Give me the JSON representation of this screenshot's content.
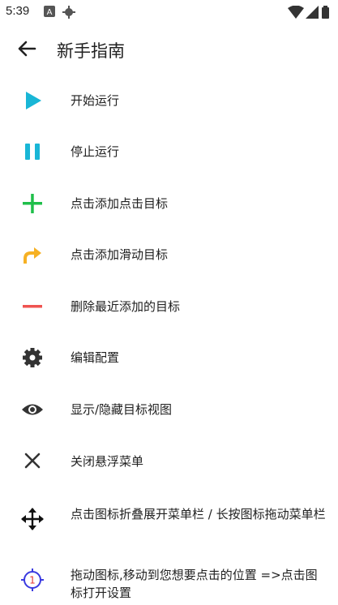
{
  "status_bar": {
    "time": "5:39"
  },
  "app_bar": {
    "title": "新手指南"
  },
  "colors": {
    "play": "#19b6d6",
    "pause": "#19b6d6",
    "add": "#1fbf4a",
    "swipe": "#f6b124",
    "remove": "#ef5350",
    "gear": "#333333",
    "target": "#3a3ae0",
    "target_num": "#e53935"
  },
  "items": [
    {
      "icon": "play-icon",
      "label": "开始运行"
    },
    {
      "icon": "pause-icon",
      "label": "停止运行"
    },
    {
      "icon": "plus-icon",
      "label": "点击添加点击目标"
    },
    {
      "icon": "swipe-arrow-icon",
      "label": "点击添加滑动目标"
    },
    {
      "icon": "minus-icon",
      "label": "删除最近添加的目标"
    },
    {
      "icon": "gear-icon",
      "label": "编辑配置"
    },
    {
      "icon": "eye-icon",
      "label": "显示/隐藏目标视图"
    },
    {
      "icon": "close-icon",
      "label": "关闭悬浮菜单"
    },
    {
      "icon": "move-icon",
      "label": "点击图标折叠展开菜单栏 / 长按图标拖动菜单栏"
    },
    {
      "icon": "target-icon",
      "label": "拖动图标,移动到您想要点击的位置 =>点击图标打开设置",
      "badge": "1"
    }
  ]
}
